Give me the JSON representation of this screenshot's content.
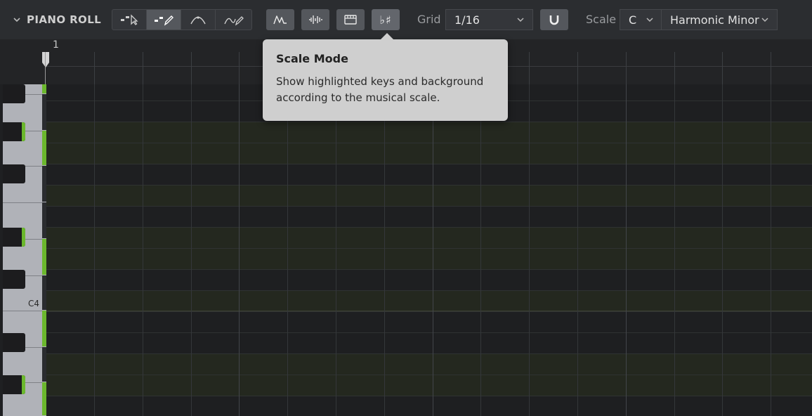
{
  "panel": {
    "title": "PIANO ROLL",
    "collapse_icon": "chevron-down-icon"
  },
  "toolbar": {
    "tool_modes": [
      {
        "name": "select-tool",
        "icon": "select-arrow-icon",
        "active": false
      },
      {
        "name": "draw-tool",
        "icon": "pencil-icon",
        "active": true
      },
      {
        "name": "curve-tool",
        "icon": "curve-icon",
        "active": false
      },
      {
        "name": "freehand-tool",
        "icon": "freehand-icon",
        "active": false
      }
    ],
    "buttons": [
      {
        "name": "velocity-curve-button",
        "icon": "wave-icon"
      },
      {
        "name": "audio-waveform-button",
        "icon": "waveform-icon"
      },
      {
        "name": "clip-view-button",
        "icon": "clip-icon"
      },
      {
        "name": "scale-mode-button",
        "icon": "flat-sharp-icon",
        "label": "♭♯"
      }
    ],
    "grid_label": "Grid",
    "grid_value": "1/16",
    "snap_icon": "magnet-icon",
    "scale_label": "Scale",
    "scale_root": "C",
    "scale_type": "Harmonic Minor"
  },
  "ruler": {
    "bar_number": "1"
  },
  "keyboard": {
    "c4_label": "C4"
  },
  "tooltip": {
    "title": "Scale Mode",
    "body": "Show highlighted keys and background according to the musical scale."
  },
  "colors": {
    "accent_green": "#6bb82d",
    "tooltip_bg": "#cfcfcf",
    "toolbar_bg": "#2b2d30"
  }
}
